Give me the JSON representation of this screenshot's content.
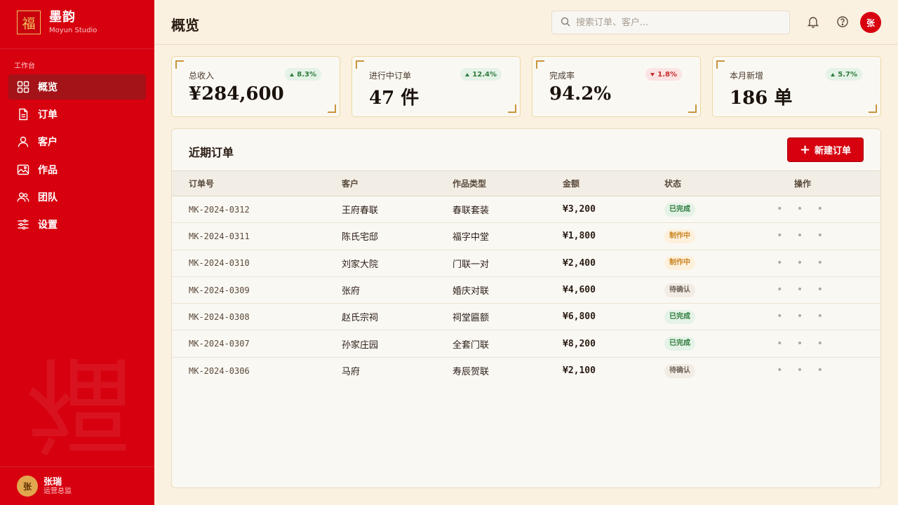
{
  "brand": {
    "logo_char": "福",
    "name": "墨韵",
    "subtitle": "Moyun Studio"
  },
  "sidebar": {
    "section_label": "工作台",
    "items": [
      {
        "label": "概览",
        "icon": "grid-icon",
        "active": true
      },
      {
        "label": "订单",
        "icon": "document-icon",
        "active": false
      },
      {
        "label": "客户",
        "icon": "user-icon",
        "active": false
      },
      {
        "label": "作品",
        "icon": "image-icon",
        "active": false
      },
      {
        "label": "团队",
        "icon": "team-icon",
        "active": false
      },
      {
        "label": "设置",
        "icon": "sliders-icon",
        "active": false
      }
    ],
    "watermark_char": "福",
    "user": {
      "avatar_char": "张",
      "name": "张瑞",
      "role": "运营总监"
    }
  },
  "header": {
    "title": "概览",
    "search_placeholder": "搜索订单、客户...",
    "avatar_char": "张"
  },
  "kpis": [
    {
      "label": "总收入",
      "value": "¥284,600",
      "change": "8.3%",
      "trend": "up"
    },
    {
      "label": "进行中订单",
      "value": "47 件",
      "change": "12.4%",
      "trend": "up"
    },
    {
      "label": "完成率",
      "value": "94.2%",
      "change": "1.8%",
      "trend": "down"
    },
    {
      "label": "本月新增",
      "value": "186 单",
      "change": "5.7%",
      "trend": "up"
    }
  ],
  "orders": {
    "title": "近期订单",
    "new_button": "新建订单",
    "columns": [
      "订单号",
      "客户",
      "作品类型",
      "金额",
      "状态",
      "操作"
    ],
    "rows": [
      {
        "id": "MK-2024-0312",
        "customer": "王府春联",
        "type": "春联套装",
        "amount": "¥3,200",
        "status": "已完成",
        "status_kind": "done"
      },
      {
        "id": "MK-2024-0311",
        "customer": "陈氏宅邸",
        "type": "福字中堂",
        "amount": "¥1,800",
        "status": "制作中",
        "status_kind": "making"
      },
      {
        "id": "MK-2024-0310",
        "customer": "刘家大院",
        "type": "门联一对",
        "amount": "¥2,400",
        "status": "制作中",
        "status_kind": "making"
      },
      {
        "id": "MK-2024-0309",
        "customer": "张府",
        "type": "婚庆对联",
        "amount": "¥4,600",
        "status": "待确认",
        "status_kind": "pending"
      },
      {
        "id": "MK-2024-0308",
        "customer": "赵氏宗祠",
        "type": "祠堂匾额",
        "amount": "¥6,800",
        "status": "已完成",
        "status_kind": "done"
      },
      {
        "id": "MK-2024-0307",
        "customer": "孙家庄园",
        "type": "全套门联",
        "amount": "¥8,200",
        "status": "已完成",
        "status_kind": "done"
      },
      {
        "id": "MK-2024-0306",
        "customer": "马府",
        "type": "寿辰贺联",
        "amount": "¥2,100",
        "status": "待确认",
        "status_kind": "pending"
      }
    ],
    "actions_glyph": "• • •"
  },
  "colors": {
    "primary_red": "#d7000f",
    "active_nav": "#a31318",
    "gold": "#c8953a",
    "cream": "#faf1e0",
    "up": "#2f7d3d",
    "down": "#c92a2a"
  }
}
